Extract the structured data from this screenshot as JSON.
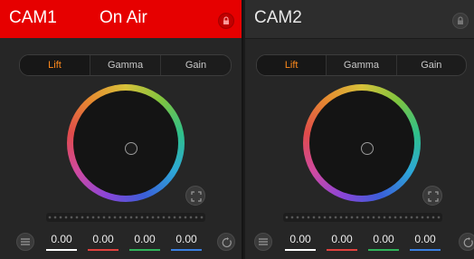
{
  "panels": [
    {
      "name": "CAM1",
      "status": "On Air",
      "tabs": [
        "Lift",
        "Gamma",
        "Gain"
      ],
      "active_tab": "Lift",
      "values": [
        "0.00",
        "0.00",
        "0.00",
        "0.00"
      ]
    },
    {
      "name": "CAM2",
      "status": "",
      "tabs": [
        "Lift",
        "Gamma",
        "Gain"
      ],
      "active_tab": "Lift",
      "values": [
        "0.00",
        "0.00",
        "0.00",
        "0.00"
      ]
    }
  ],
  "colors": {
    "on_air": "#e60000",
    "active_tab": "#ff8a1c",
    "luma": "#ffffff",
    "red": "#e0413e",
    "green": "#2fb35a",
    "blue": "#3a7fe0"
  },
  "icons": [
    "lock-icon",
    "expand-icon",
    "menu-icon",
    "reset-icon"
  ]
}
